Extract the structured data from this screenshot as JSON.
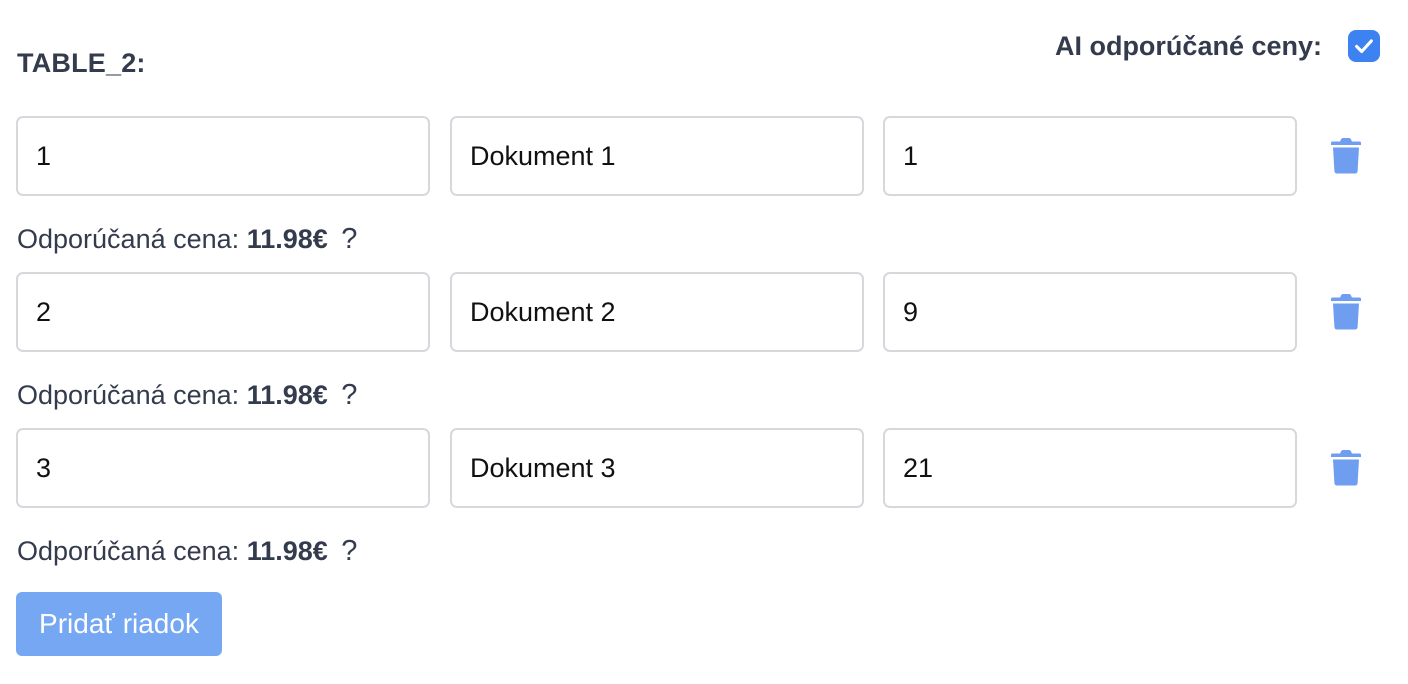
{
  "table": {
    "title": "TABLE_2:",
    "ai_label": "AI odporúčané ceny:",
    "ai_checked": true,
    "rows": [
      {
        "col1": "1",
        "col2": "Dokument 1",
        "col3": "1",
        "rec_label": "Odporúčaná cena:",
        "rec_price": "11.98€",
        "help": "?"
      },
      {
        "col1": "2",
        "col2": "Dokument 2",
        "col3": "9",
        "rec_label": "Odporúčaná cena:",
        "rec_price": "11.98€",
        "help": "?"
      },
      {
        "col1": "3",
        "col2": "Dokument 3",
        "col3": "21",
        "rec_label": "Odporúčaná cena:",
        "rec_price": "11.98€",
        "help": "?"
      }
    ],
    "add_button": "Pridať riadok"
  },
  "icons": {
    "checkbox": "check-icon",
    "delete": "trash-icon",
    "help": "question-icon"
  },
  "colors": {
    "accent": "#3d82f1",
    "button": "#75a7f3",
    "trash": "#6f9ef0",
    "text": "#333b4d"
  }
}
